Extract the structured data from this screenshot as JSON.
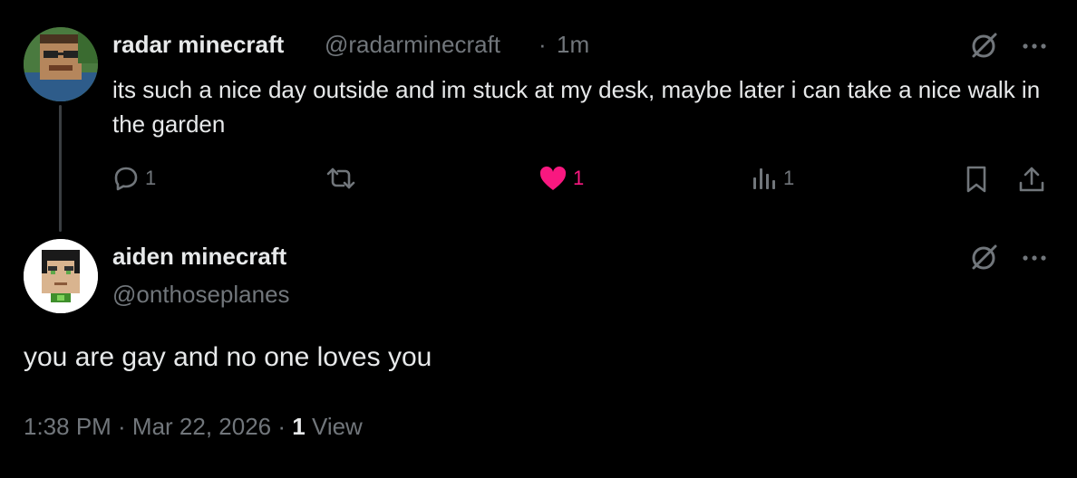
{
  "tweet1": {
    "display_name": "radar minecraft",
    "handle": "@radarminecraft",
    "separator": "·",
    "time": "1m",
    "text": "its such a nice day outside and im stuck at my desk, maybe later i can take a nice walk in the garden",
    "reply_count": "1",
    "like_count": "1",
    "view_count": "1",
    "icons": [
      "grok-icon",
      "more-icon",
      "reply-icon",
      "retweet-icon",
      "heart-icon",
      "views-icon",
      "bookmark-icon",
      "share-icon"
    ]
  },
  "tweet2": {
    "display_name": "aiden minecraft",
    "handle": "@onthoseplanes",
    "text": "you are gay and no one loves you",
    "timestamp": "1:38 PM · Mar 22, 2026 · ",
    "views_number": "1",
    "views_label": " View",
    "icons": [
      "grok-icon",
      "more-icon"
    ]
  },
  "colors": {
    "background": "#000000",
    "text": "#e7e9ea",
    "secondary": "#71767b",
    "like": "#f91880"
  }
}
